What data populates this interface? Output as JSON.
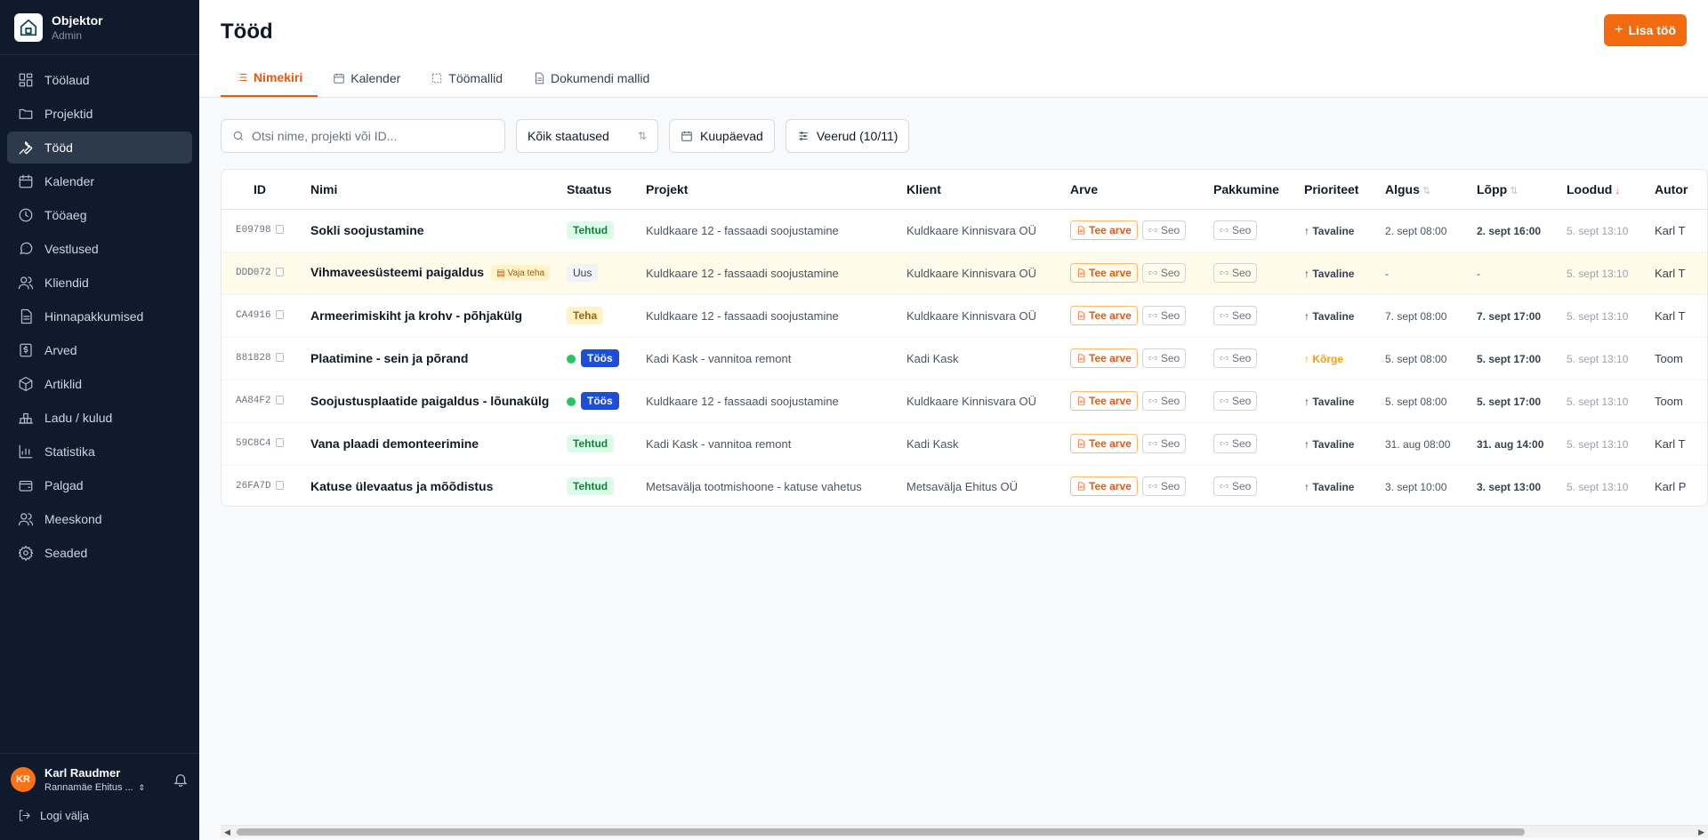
{
  "app": {
    "name": "Objektor",
    "role": "Admin"
  },
  "sidebar": {
    "items": [
      {
        "label": "Töölaud",
        "icon": "dashboard-icon"
      },
      {
        "label": "Projektid",
        "icon": "folder-icon"
      },
      {
        "label": "Tööd",
        "icon": "wrench-icon",
        "active": true
      },
      {
        "label": "Kalender",
        "icon": "calendar-icon"
      },
      {
        "label": "Tööaeg",
        "icon": "clock-icon"
      },
      {
        "label": "Vestlused",
        "icon": "chat-icon"
      },
      {
        "label": "Kliendid",
        "icon": "users-icon"
      },
      {
        "label": "Hinnapakkumised",
        "icon": "document-icon"
      },
      {
        "label": "Arved",
        "icon": "invoice-icon"
      },
      {
        "label": "Artiklid",
        "icon": "box-icon"
      },
      {
        "label": "Ladu / kulud",
        "icon": "warehouse-icon"
      },
      {
        "label": "Statistika",
        "icon": "chart-icon"
      },
      {
        "label": "Palgad",
        "icon": "wallet-icon"
      },
      {
        "label": "Meeskond",
        "icon": "team-icon"
      },
      {
        "label": "Seaded",
        "icon": "gear-icon"
      }
    ]
  },
  "user": {
    "initials": "KR",
    "name": "Karl Raudmer",
    "company": "Rannamäe Ehitus ...",
    "logout": "Logi välja"
  },
  "header": {
    "title": "Tööd",
    "add_button": "Lisa töö"
  },
  "tabs": [
    {
      "label": "Nimekiri",
      "active": true
    },
    {
      "label": "Kalender"
    },
    {
      "label": "Töömallid"
    },
    {
      "label": "Dokumendi mallid"
    }
  ],
  "filters": {
    "search_placeholder": "Otsi nime, projekti või ID...",
    "status": "Kõik staatused",
    "dates": "Kuupäevad",
    "columns": "Veerud (10/11)"
  },
  "table": {
    "columns": [
      "ID",
      "Nimi",
      "Staatus",
      "Projekt",
      "Klient",
      "Arve",
      "Pakkumine",
      "Prioriteet",
      "Algus",
      "Lõpp",
      "Loodud",
      "Autor"
    ],
    "invoice_label": "Tee arve",
    "link_label": "Seo",
    "rows": [
      {
        "id": "E09798",
        "name": "Sokli soojustamine",
        "status": "Tehtud",
        "status_type": "done",
        "project": "Kuldkaare 12 - fassaadi soojustamine",
        "client": "Kuldkaare Kinnisvara OÜ",
        "priority": "↑ Tavaline",
        "priority_type": "normal",
        "start": "2. sept 08:00",
        "end": "2. sept 16:00",
        "created": "5. sept 13:10",
        "author": "Karl T"
      },
      {
        "id": "DDD072",
        "name": "Vihmaveesüsteemi paigaldus",
        "tag": "Vaja teha",
        "status": "Uus",
        "status_type": "new",
        "project": "Kuldkaare 12 - fassaadi soojustamine",
        "client": "Kuldkaare Kinnisvara OÜ",
        "priority": "↑ Tavaline",
        "priority_type": "normal",
        "start": "-",
        "end": "-",
        "created": "5. sept 13:10",
        "author": "Karl T",
        "highlighted": true
      },
      {
        "id": "CA4916",
        "name": "Armeerimiskiht ja krohv - põhjakülg",
        "status": "Teha",
        "status_type": "todo",
        "project": "Kuldkaare 12 - fassaadi soojustamine",
        "client": "Kuldkaare Kinnisvara OÜ",
        "priority": "↑ Tavaline",
        "priority_type": "normal",
        "start": "7. sept 08:00",
        "end": "7. sept 17:00",
        "created": "5. sept 13:10",
        "author": "Karl T"
      },
      {
        "id": "881828",
        "name": "Plaatimine - sein ja põrand",
        "status": "Töös",
        "status_type": "progress",
        "project": "Kadi Kask - vannitoa remont",
        "client": "Kadi Kask",
        "priority": "↑ Kõrge",
        "priority_type": "high",
        "start": "5. sept 08:00",
        "end": "5. sept 17:00",
        "created": "5. sept 13:10",
        "author": "Toom"
      },
      {
        "id": "AA84F2",
        "name": "Soojustusplaatide paigaldus - lõunakülg",
        "status": "Töös",
        "status_type": "progress",
        "project": "Kuldkaare 12 - fassaadi soojustamine",
        "client": "Kuldkaare Kinnisvara OÜ",
        "priority": "↑ Tavaline",
        "priority_type": "normal",
        "start": "5. sept 08:00",
        "end": "5. sept 17:00",
        "created": "5. sept 13:10",
        "author": "Toom"
      },
      {
        "id": "59C8C4",
        "name": "Vana plaadi demonteerimine",
        "status": "Tehtud",
        "status_type": "done",
        "project": "Kadi Kask - vannitoa remont",
        "client": "Kadi Kask",
        "priority": "↑ Tavaline",
        "priority_type": "normal",
        "start": "31. aug 08:00",
        "end": "31. aug 14:00",
        "created": "5. sept 13:10",
        "author": "Karl T"
      },
      {
        "id": "26FA7D",
        "name": "Katuse ülevaatus ja mõõdistus",
        "status": "Tehtud",
        "status_type": "done",
        "project": "Metsavälja tootmishoone - katuse vahetus",
        "client": "Metsavälja Ehitus OÜ",
        "priority": "↑ Tavaline",
        "priority_type": "normal",
        "start": "3. sept 10:00",
        "end": "3. sept 13:00",
        "created": "5. sept 13:10",
        "author": "Karl P"
      }
    ]
  },
  "colors": {
    "accent": "#f26b10",
    "sidebar_bg": "#0f1b2d",
    "active_nav": "#2d3a4d",
    "progress_badge": "#1d4ed8"
  }
}
